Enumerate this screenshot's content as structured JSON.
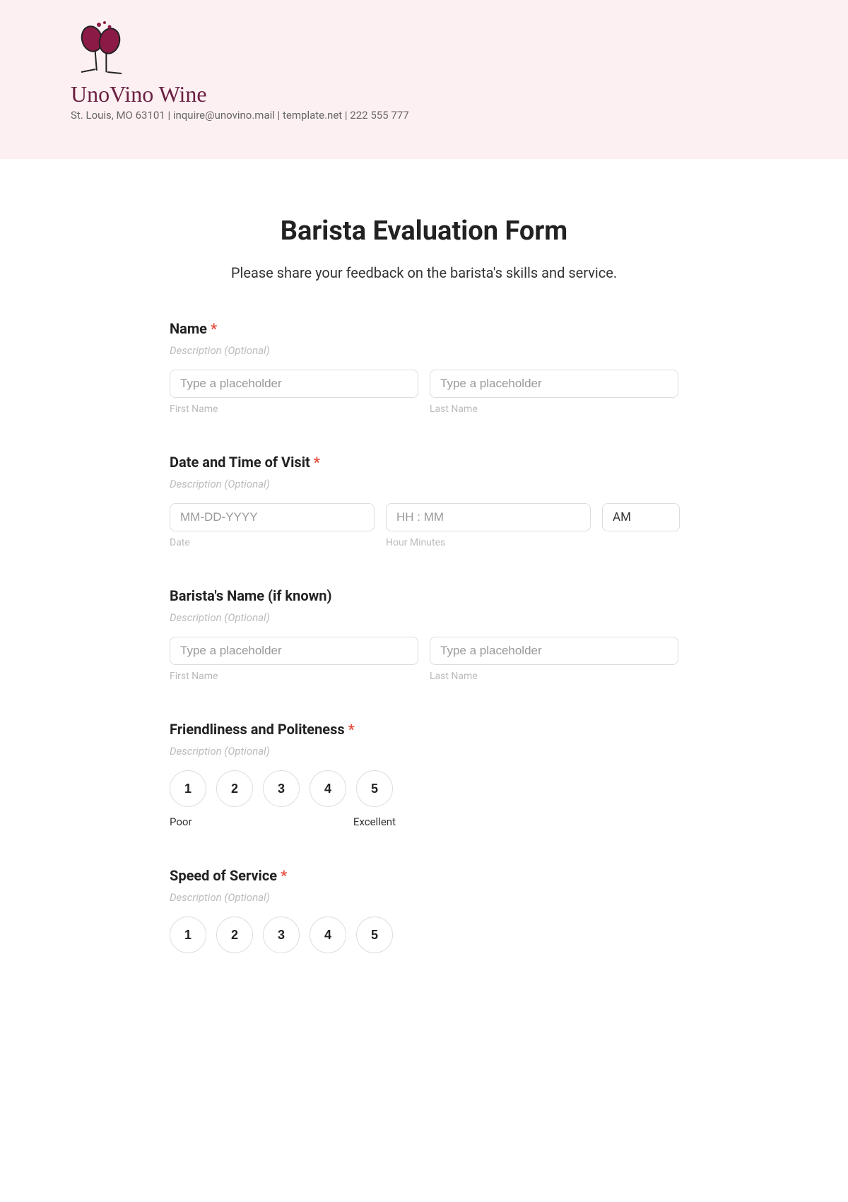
{
  "header": {
    "brand_name": "UnoVino Wine",
    "contact_line": "St. Louis, MO 63101 | inquire@unovino.mail | template.net | 222 555 777"
  },
  "form": {
    "title": "Barista Evaluation Form",
    "subtitle": "Please share your feedback on the barista's skills and service."
  },
  "fields": {
    "name": {
      "label": "Name",
      "required_mark": "*",
      "desc": "Description (Optional)",
      "first_placeholder": "Type a placeholder",
      "last_placeholder": "Type a placeholder",
      "first_sub": "First Name",
      "last_sub": "Last Name"
    },
    "visit": {
      "label": "Date and Time of Visit",
      "required_mark": "*",
      "desc": "Description (Optional)",
      "date_placeholder": "MM-DD-YYYY",
      "time_placeholder": "HH : MM",
      "ampm": "AM",
      "date_sub": "Date",
      "time_sub": "Hour Minutes"
    },
    "barista_name": {
      "label": "Barista's Name (if known)",
      "desc": "Description (Optional)",
      "first_placeholder": "Type a placeholder",
      "last_placeholder": "Type a placeholder",
      "first_sub": "First Name",
      "last_sub": "Last Name"
    },
    "friendliness": {
      "label": "Friendliness and Politeness",
      "required_mark": "*",
      "desc": "Description (Optional)",
      "options": [
        "1",
        "2",
        "3",
        "4",
        "5"
      ],
      "low_label": "Poor",
      "high_label": "Excellent"
    },
    "speed": {
      "label": "Speed of Service",
      "required_mark": "*",
      "desc": "Description (Optional)",
      "options": [
        "1",
        "2",
        "3",
        "4",
        "5"
      ]
    }
  }
}
